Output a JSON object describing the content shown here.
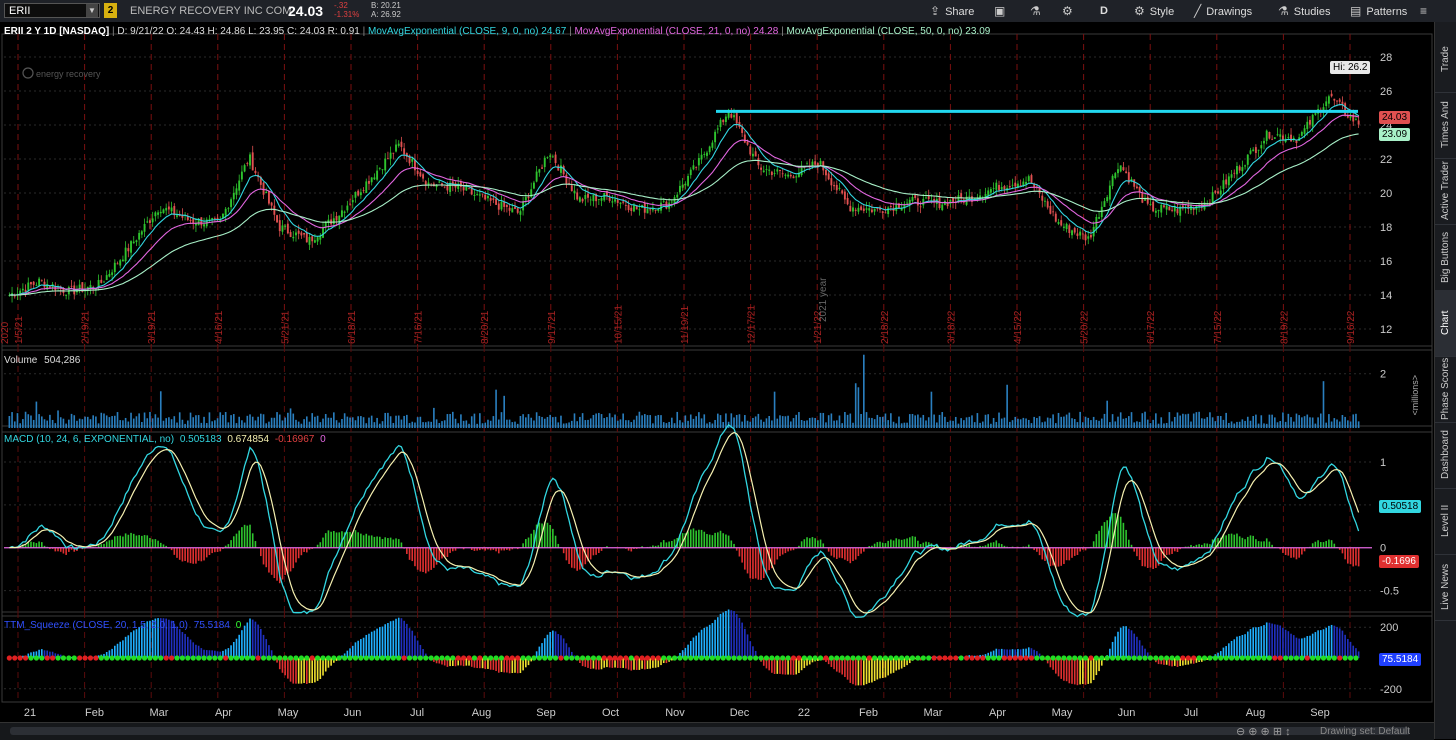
{
  "toolbar": {
    "symbol": "ERII",
    "link_badge": "2",
    "company": "ENERGY RECOVERY INC COM",
    "last": "24.03",
    "change": "-.32",
    "change_pct": "-1.31%",
    "bid": "B: 20.21",
    "ask": "A: 26.92",
    "share_label": "Share",
    "aggregation": "D",
    "style_label": "Style",
    "drawings_label": "Drawings",
    "studies_label": "Studies",
    "patterns_label": "Patterns"
  },
  "sidebar": {
    "tabs": [
      "Trade",
      "Times And Sales",
      "Active Trader",
      "Big Buttons",
      "Chart",
      "Phase Scores",
      "Dashboard",
      "Level II",
      "Live News"
    ],
    "active": "Chart"
  },
  "price_panel": {
    "header": "ERII 2 Y 1D [NASDAQ]",
    "ohlc": {
      "d": "D: 9/21/22",
      "o": "O: 24.43",
      "h": "H: 24.86",
      "l": "L: 23.95",
      "c": "C: 24.03",
      "r": "R: 0.91"
    },
    "studies": [
      {
        "label": "MovAvgExponential (CLOSE, 9, 0, no)",
        "value": "24.67",
        "color": "#32d6e0"
      },
      {
        "label": "MovAvgExponential (CLOSE, 21, 0, no)",
        "value": "24.28",
        "color": "#e266e0"
      },
      {
        "label": "MovAvgExponential (CLOSE, 50, 0, no)",
        "value": "23.09",
        "color": "#a8f0c8"
      }
    ],
    "watermark": "energy recovery",
    "hi_label": "Hi: 26.2",
    "last_box": "24.03",
    "ema50_box": "23.09",
    "year_label": "2021 year",
    "year_start_label": "2020",
    "y_ticks": [
      28,
      26,
      24,
      22,
      20,
      18,
      16,
      14,
      12
    ]
  },
  "chart_data": {
    "type": "candlestick",
    "symbol": "ERII",
    "period": "2 Y 1D",
    "x_months": [
      "21",
      "Feb",
      "Mar",
      "Apr",
      "May",
      "Jun",
      "Jul",
      "Aug",
      "Sep",
      "Oct",
      "Nov",
      "Dec",
      "22",
      "Feb",
      "Mar",
      "Apr",
      "May",
      "Jun",
      "Jul",
      "Aug",
      "Sep"
    ],
    "vertical_date_labels": [
      "1/5/21",
      "2/19/21",
      "3/19/21",
      "4/16/21",
      "5/21/21",
      "6/18/21",
      "7/16/21",
      "8/20/21",
      "9/17/21",
      "10/15/21",
      "11/19/21",
      "12/17/21",
      "1/21/22",
      "2/18/22",
      "3/18/22",
      "4/15/22",
      "5/20/22",
      "6/17/22",
      "7/15/22",
      "8/19/22",
      "9/16/22"
    ],
    "close_approx": [
      14.0,
      14.8,
      14.2,
      14.6,
      16.8,
      19.2,
      18.4,
      18.2,
      22.1,
      18.0,
      17.2,
      18.8,
      20.8,
      22.8,
      20.5,
      20.3,
      19.5,
      18.8,
      22.5,
      19.6,
      19.8,
      19.0,
      19.4,
      21.8,
      24.9,
      21.5,
      21.0,
      21.8,
      19.2,
      19.0,
      19.5,
      19.4,
      19.7,
      20.4,
      20.8,
      18.2,
      17.3,
      21.8,
      19.1,
      19.0,
      19.5,
      21.5,
      23.5,
      23.2,
      25.7,
      24.03
    ],
    "resistance_level": 24.8,
    "ylim": [
      11,
      29
    ],
    "volume": {
      "label": "Volume",
      "value": "504,286",
      "unit": "<millions>",
      "y_ticks": [
        2
      ]
    },
    "macd": {
      "label": "MACD (10, 24, 6, EXPONENTIAL, no)",
      "value": "0.505183",
      "avg": "0.674854",
      "diff": "-0.16967",
      "zero": "0",
      "y_ticks": [
        1,
        0.5,
        0,
        -0.5
      ],
      "value_box": "0.50518",
      "diff_box": "-0.1696"
    },
    "ttm_squeeze": {
      "label": "TTM_Squeeze (CLOSE, 20, 1.5, 2.0, 1.0)",
      "value": "75.5184",
      "zero": "0",
      "y_ticks": [
        200,
        0,
        -200
      ],
      "value_box": "75.5184"
    }
  },
  "status": {
    "drawing_set": "Drawing set: Default"
  }
}
